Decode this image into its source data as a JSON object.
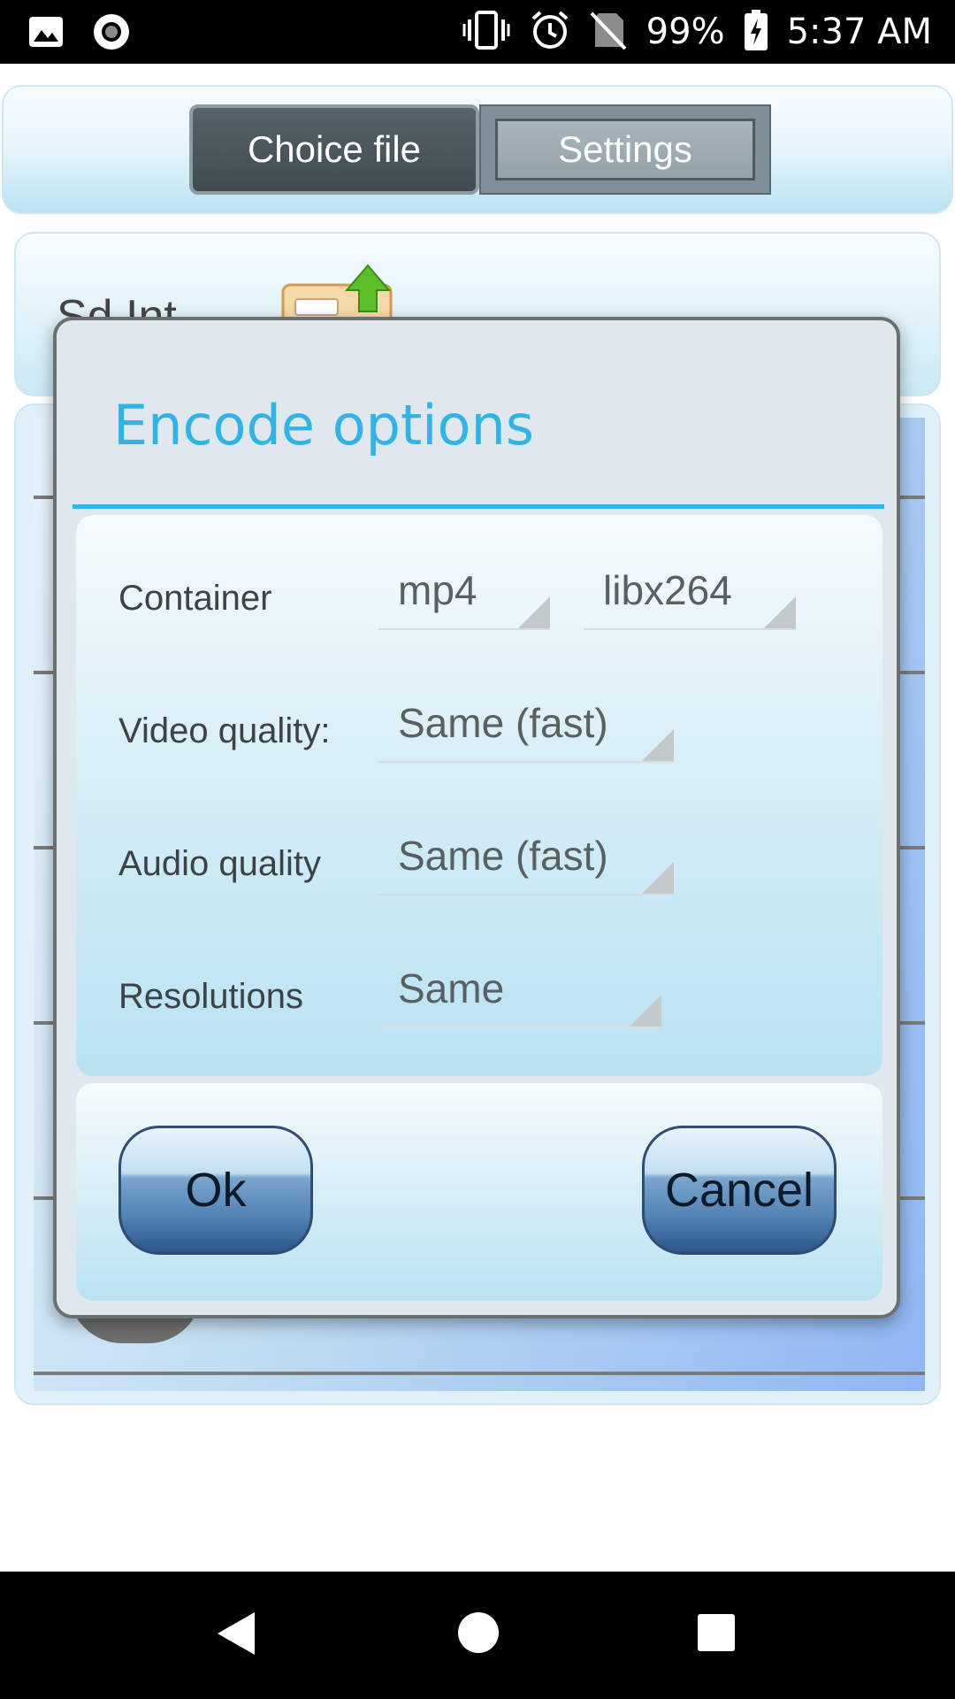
{
  "status_bar": {
    "battery": "99%",
    "time": "5:37 AM",
    "icons": [
      "image-icon",
      "record-icon",
      "vibrate-icon",
      "alarm-icon",
      "no-sim-icon",
      "battery-charging-icon"
    ]
  },
  "tabs": {
    "choice_file": "Choice file",
    "settings": "Settings"
  },
  "background": {
    "storage_label": "Sd Int"
  },
  "dialog": {
    "title": "Encode options",
    "rows": [
      {
        "label": "Container",
        "values": [
          "mp4",
          "libx264"
        ]
      },
      {
        "label": "Video quality:",
        "values": [
          "Same (fast)"
        ]
      },
      {
        "label": "Audio quality",
        "values": [
          "Same (fast)"
        ]
      },
      {
        "label": "Resolutions",
        "values": [
          "Same"
        ]
      }
    ],
    "ok_label": "Ok",
    "cancel_label": "Cancel"
  },
  "colors": {
    "title_accent": "#33b3e5",
    "status_bar": "#000000"
  }
}
